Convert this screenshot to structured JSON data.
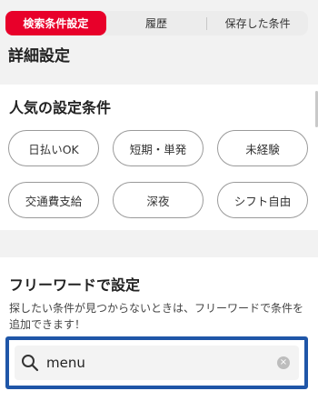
{
  "tabs": [
    {
      "label": "検索条件設定",
      "active": true
    },
    {
      "label": "履歴",
      "active": false
    },
    {
      "label": "保存した条件",
      "active": false
    }
  ],
  "page_title": "詳細設定",
  "popular": {
    "title": "人気の設定条件",
    "chips": [
      "日払いOK",
      "短期・単発",
      "未経験",
      "交通費支給",
      "深夜",
      "シフト自由"
    ]
  },
  "freeword": {
    "title": "フリーワードで設定",
    "description": "探したい条件が見つからないときは、フリーワードで条件を追加できます！",
    "search_value": "menu",
    "clear_label": "×"
  },
  "colors": {
    "accent": "#e8002a",
    "focus_border": "#1f56a8"
  }
}
